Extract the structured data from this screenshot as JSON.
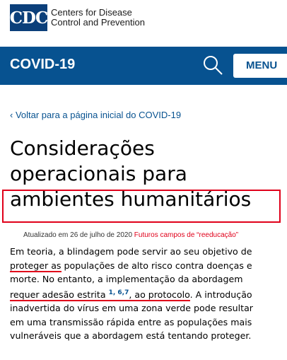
{
  "brand": {
    "logo_text": "CDC",
    "name_line1": "Centers for Disease",
    "name_line2": "Control and Prevention",
    "colors": {
      "primary": "#075290",
      "logo": "#0b3f7a",
      "highlight": "#e0001a"
    }
  },
  "topbar": {
    "title": "COVID-19",
    "search_icon": "search-icon",
    "menu_label": "MENU"
  },
  "back_link": "‹ Voltar para a página inicial do COVID-19",
  "title_lines": [
    "Considerações",
    "operacionais para",
    "ambientes humanitários"
  ],
  "updated": "Atualizado em 26 de julho de 2020",
  "annotation": "Futuros campos de “reeducação”",
  "body": {
    "l1": "Em teoria, a blindagem pode servir ao seu objetivo de",
    "l2_u": "proteger as",
    "l2_rest": " populações de alto risco contra doenças e",
    "l3": "morte. No entanto, a implementação da abordagem",
    "l4_u1": "requer adesão estrita ",
    "l4_sup": "1, 6,7",
    "l4_u2": ", ao protocolo",
    "l4_rest": ". A introdução",
    "l5": "inadvertida do vírus em uma zona verde pode resultar",
    "l6": "em uma transmissão rápida entre as populações mais",
    "l7": "vulneráveis que a abordagem está tentando proteger."
  }
}
